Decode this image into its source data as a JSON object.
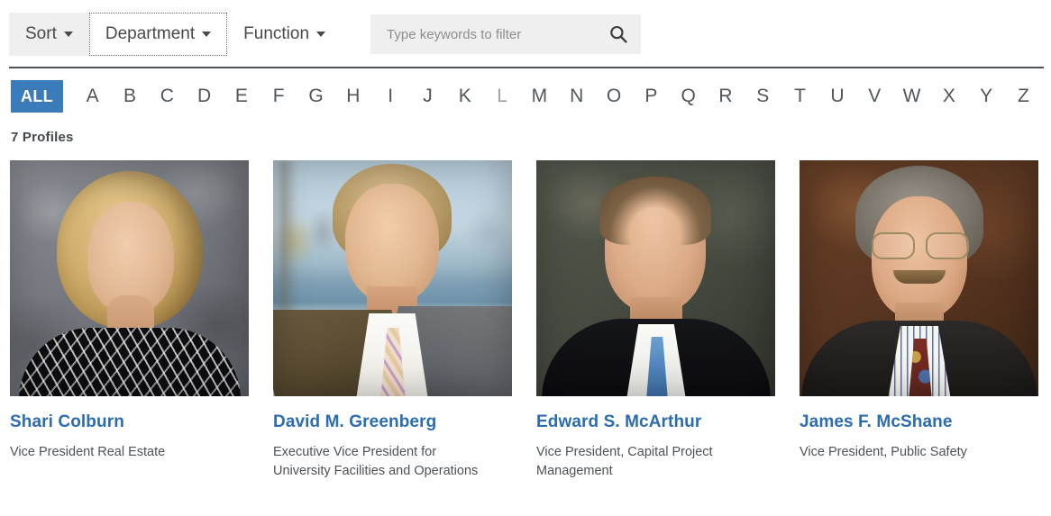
{
  "toolbar": {
    "sort_label": "Sort",
    "department_label": "Department",
    "function_label": "Function",
    "search_placeholder": "Type keywords to filter",
    "search_value": "",
    "search_icon": "search-icon",
    "caret_icon": "chevron-down-icon"
  },
  "alphabet": {
    "all_label": "ALL",
    "active": "ALL",
    "dimmed_letters": [
      "L"
    ],
    "letters": [
      "A",
      "B",
      "C",
      "D",
      "E",
      "F",
      "G",
      "H",
      "I",
      "J",
      "K",
      "L",
      "M",
      "N",
      "O",
      "P",
      "Q",
      "R",
      "S",
      "T",
      "U",
      "V",
      "W",
      "X",
      "Y",
      "Z"
    ]
  },
  "results": {
    "count_label": "7 Profiles"
  },
  "colors": {
    "accent_blue": "#3a7cba",
    "link_blue": "#2c6cb0",
    "toolbar_shade": "#efefef",
    "rule": "#4f5559",
    "body_text": "#4d5257"
  },
  "profiles": [
    {
      "name": "Shari Colburn",
      "title": "Vice President Real Estate",
      "photo_alt": "portrait-shari-colburn"
    },
    {
      "name": "David M. Greenberg",
      "title": "Executive Vice President for\nUniversity Facilities and Operations",
      "photo_alt": "portrait-david-m-greenberg"
    },
    {
      "name": "Edward S. McArthur",
      "title": "Vice President, Capital Project\nManagement",
      "photo_alt": "portrait-edward-s-mcarthur"
    },
    {
      "name": "James F. McShane",
      "title": "Vice President, Public Safety",
      "photo_alt": "portrait-james-f-mcshane"
    }
  ]
}
